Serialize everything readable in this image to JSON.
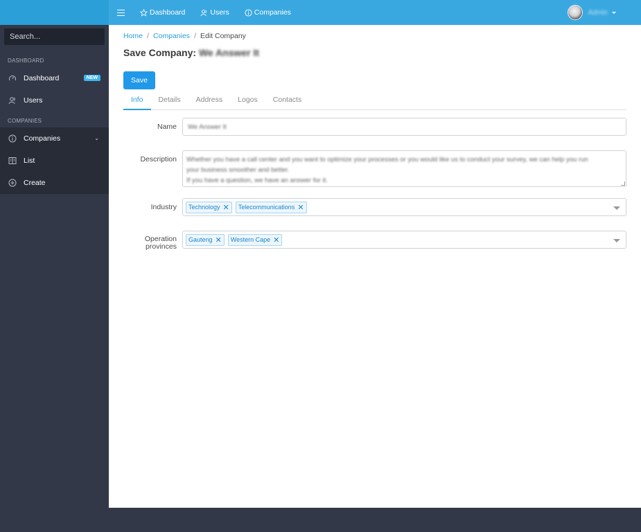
{
  "sidebar": {
    "search_placeholder": "Search...",
    "sections": [
      {
        "title": "DASHBOARD"
      },
      {
        "title": "COMPANIES"
      }
    ],
    "items": [
      {
        "label": "Dashboard",
        "icon": "speedometer-icon",
        "badge": "NEW"
      },
      {
        "label": "Users",
        "icon": "users-icon"
      },
      {
        "label": "Companies",
        "icon": "info-circle-icon",
        "expanded": true
      },
      {
        "label": "List",
        "icon": "list-icon"
      },
      {
        "label": "Create",
        "icon": "plus-circle-icon"
      }
    ]
  },
  "topbar": {
    "links": [
      {
        "label": "Dashboard",
        "icon": "star-icon"
      },
      {
        "label": "Users",
        "icon": "users-icon"
      },
      {
        "label": "Companies",
        "icon": "info-circle-icon"
      }
    ],
    "user_name": "Admin"
  },
  "breadcrumb": {
    "items": [
      "Home",
      "Companies",
      "Edit Company"
    ]
  },
  "page": {
    "title_prefix": "Save Company:",
    "company_name": "We Answer It",
    "save_label": "Save"
  },
  "tabs": [
    "Info",
    "Details",
    "Address",
    "Logos",
    "Contacts"
  ],
  "form": {
    "name_label": "Name",
    "name_value": "We Answer It",
    "description_label": "Description",
    "description_lines": [
      "Whether you have a call center and you want to optimize your processes or you would like us to conduct your survey, we can help you run",
      "your business smoother and better.",
      "If you have a question, we have an answer for it."
    ],
    "industry_label": "Industry",
    "industry_tags": [
      "Technology",
      "Telecommunications"
    ],
    "provinces_label_line1": "Operation",
    "provinces_label_line2": "provinces",
    "province_tags": [
      "Gauteng",
      "Western Cape"
    ]
  },
  "colors": {
    "topbar": "#3aa8e0",
    "sidebar": "#323847",
    "accent": "#2199e8"
  }
}
